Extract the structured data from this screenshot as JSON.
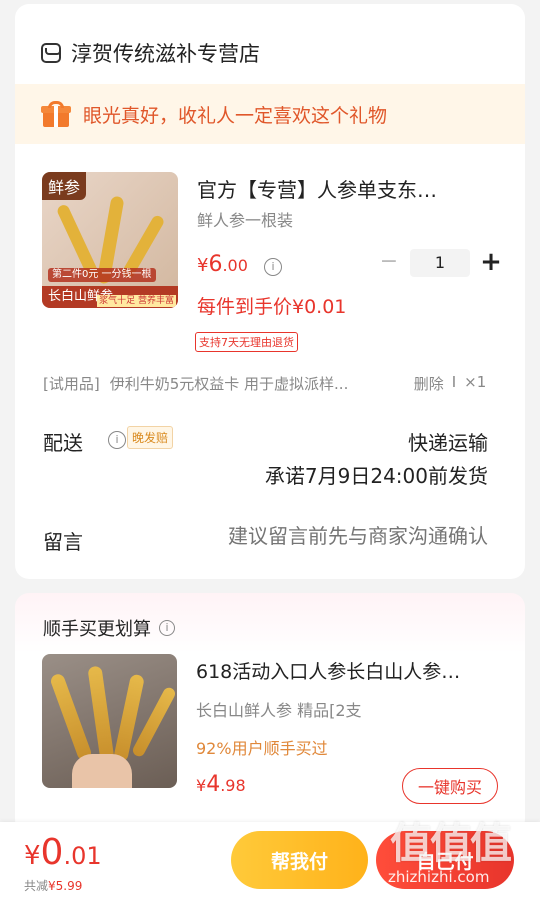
{
  "store": {
    "name": "淳贺传统滋补专营店",
    "icon": "store-icon"
  },
  "gift_banner": {
    "text": "眼光真好，收礼人一定喜欢这个礼物",
    "icon": "gift-icon"
  },
  "product": {
    "image_tag": "鲜参",
    "image_band": "长白山鲜参",
    "image_note": "第二件0元 一分钱一根",
    "image_note2": "浆气十足 营养丰富",
    "title": "官方【专营】人参单支东…",
    "spec": "鲜人参一根装",
    "price_currency": "¥",
    "price_int": "6",
    "price_dec": ".00",
    "quantity": "1",
    "final_price": "每件到手价¥0.01",
    "return_badge": "支持7天无理由退货"
  },
  "trial": {
    "tag": "[试用品]",
    "name": "伊利牛奶5元权益卡 用于虚拟派样...",
    "delete": "删除",
    "separator": "I",
    "qty": "×1"
  },
  "shipping": {
    "label": "配送",
    "badge": "晚发赔",
    "method": "快递运输",
    "promise": "承诺7月9日24:00前发货"
  },
  "note": {
    "label": "留言",
    "placeholder": "建议留言前先与商家沟通确认"
  },
  "recommend": {
    "title": "顺手买更划算",
    "name": "618活动入口人参长白山人参…",
    "sub": "长白山鲜人参   精品[2支",
    "percent": "92%用户顺手买过",
    "price_currency": "¥",
    "price_int": "4",
    "price_dec": ".98",
    "buy_label": "一键购买"
  },
  "bottom": {
    "currency": "¥",
    "total_int": "0",
    "total_dec": ".01",
    "saved_label": "共减",
    "saved_amount": "¥5.99",
    "pay_friend": "帮我付",
    "pay_self": "自己付"
  },
  "watermark": {
    "big": "值值值",
    "small": "zhizhizhi.com"
  },
  "colors": {
    "accent_red": "#e8352c",
    "orange": "#e0572a",
    "yellow": "#ffc229"
  }
}
